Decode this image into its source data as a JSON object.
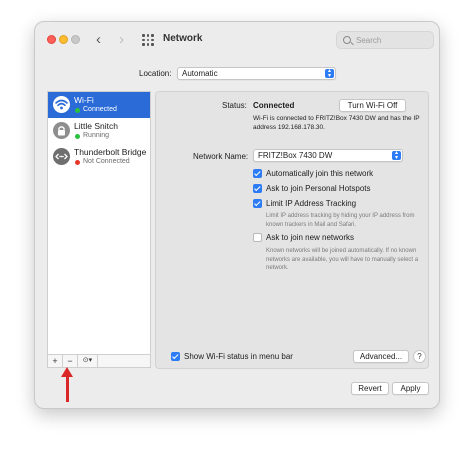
{
  "window": {
    "title": "Network",
    "back_glyph": "‹",
    "forward_glyph": "›",
    "search_placeholder": "Search"
  },
  "location": {
    "label": "Location:",
    "value": "Automatic"
  },
  "sidebar": {
    "services": [
      {
        "name": "Wi-Fi",
        "status": "Connected",
        "status_color": "#2ac23e",
        "icon": "wifi-icon",
        "selected": true
      },
      {
        "name": "Little Snitch",
        "status": "Running",
        "status_color": "#2ac23e",
        "icon": "lock-icon",
        "selected": false
      },
      {
        "name": "Thunderbolt Bridge",
        "status": "Not Connected",
        "status_color": "#e5362c",
        "icon": "thunderbolt-bridge-icon",
        "selected": false
      }
    ],
    "add_label": "+",
    "remove_label": "−",
    "action_label": "⊙▾"
  },
  "detail": {
    "status_label": "Status:",
    "status_value": "Connected",
    "turn_off_label": "Turn Wi-Fi Off",
    "status_detail": "Wi-Fi is connected to FRITZ!Box 7430 DW and has the IP address 192.168.178.30.",
    "network_name_label": "Network Name:",
    "network_name_value": "FRITZ!Box 7430 DW",
    "checkboxes": {
      "auto_join": {
        "label": "Automatically join this network",
        "checked": true
      },
      "personal_hotspots": {
        "label": "Ask to join Personal Hotspots",
        "checked": true
      },
      "limit_ip": {
        "label": "Limit IP Address Tracking",
        "checked": true
      },
      "ask_new": {
        "label": "Ask to join new networks",
        "checked": false
      },
      "menu_bar": {
        "label": "Show Wi-Fi status in menu bar",
        "checked": true
      }
    },
    "limit_ip_hint": "Limit IP address tracking by hiding your IP address from known trackers in Mail and Safari.",
    "ask_new_hint": "Known networks will be joined automatically. If no known networks are available, you will have to manually select a network.",
    "advanced_label": "Advanced...",
    "help_label": "?"
  },
  "footer": {
    "revert_label": "Revert",
    "apply_label": "Apply"
  },
  "colors": {
    "accent": "#2d7cf6",
    "selection": "#2a6bd8",
    "annotation_arrow": "#d92626"
  }
}
